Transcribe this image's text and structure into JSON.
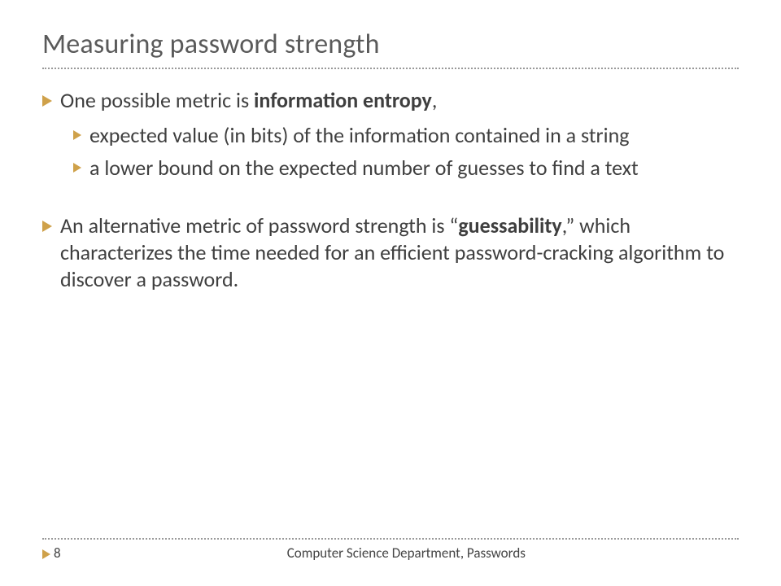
{
  "title": "Measuring password strength",
  "bullets": {
    "b1a": "One possible metric is ",
    "b1b": "information entropy",
    "b1c": ",",
    "s1": "expected value (in bits) of the information contained in a string",
    "s2": "a lower bound on the expected number of guesses to find a text",
    "b2a": "An alternative metric of password strength is “",
    "b2b": "guessability",
    "b2c": ",” which characterizes the time needed for an efficient password-cracking algorithm to discover a password."
  },
  "footer": {
    "page": "8",
    "text": "Computer Science Department, Passwords"
  },
  "accent": "#cfa14a"
}
